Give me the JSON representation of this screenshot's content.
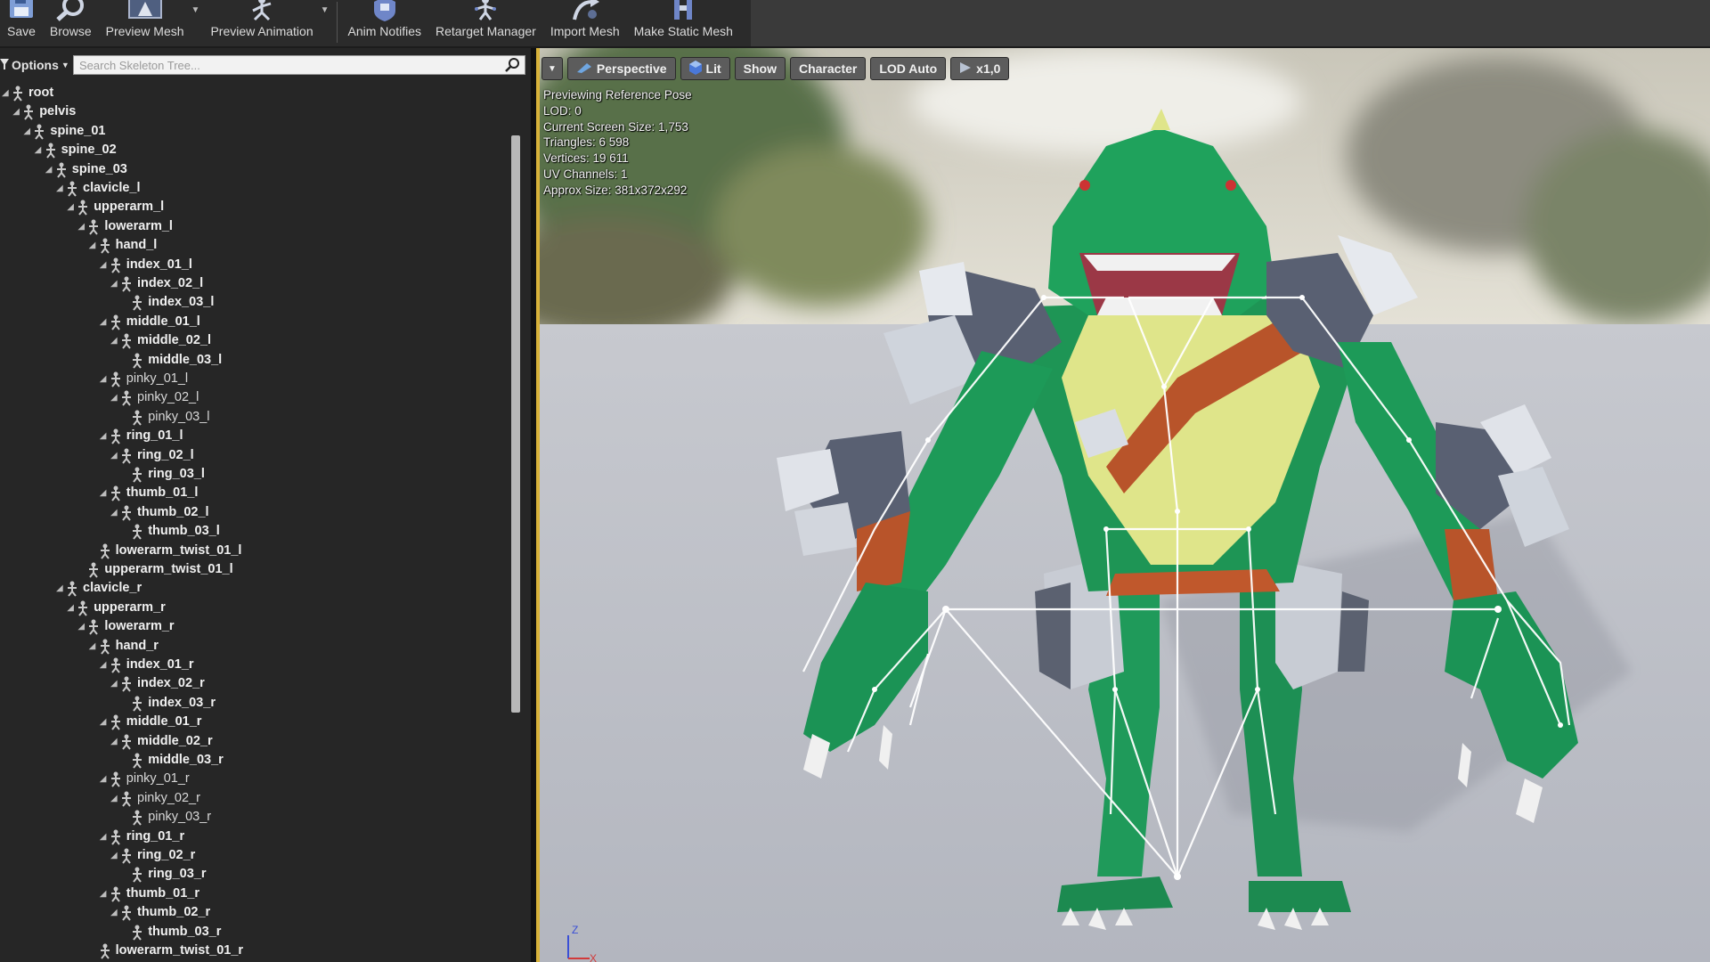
{
  "toolbar": {
    "items": [
      {
        "label": "Save",
        "icon": "save-icon"
      },
      {
        "label": "Browse",
        "icon": "browse-icon"
      },
      {
        "label": "Preview Mesh",
        "icon": "preview-mesh-icon"
      },
      {
        "label": "Preview Animation",
        "icon": "preview-animation-icon"
      },
      {
        "label": "Anim Notifies",
        "icon": "anim-notifies-icon"
      },
      {
        "label": "Retarget Manager",
        "icon": "retarget-manager-icon"
      },
      {
        "label": "Import Mesh",
        "icon": "import-mesh-icon"
      },
      {
        "label": "Make Static Mesh",
        "icon": "make-static-mesh-icon"
      }
    ]
  },
  "skeleton_panel": {
    "options_label": "Options",
    "search_placeholder": "Search Skeleton Tree...",
    "bones": [
      {
        "name": "root",
        "depth": 0,
        "expand": true,
        "bold": true
      },
      {
        "name": "pelvis",
        "depth": 1,
        "expand": true,
        "bold": true
      },
      {
        "name": "spine_01",
        "depth": 2,
        "expand": true,
        "bold": true
      },
      {
        "name": "spine_02",
        "depth": 3,
        "expand": true,
        "bold": true
      },
      {
        "name": "spine_03",
        "depth": 4,
        "expand": true,
        "bold": true
      },
      {
        "name": "clavicle_l",
        "depth": 5,
        "expand": true,
        "bold": true
      },
      {
        "name": "upperarm_l",
        "depth": 6,
        "expand": true,
        "bold": true
      },
      {
        "name": "lowerarm_l",
        "depth": 7,
        "expand": true,
        "bold": true
      },
      {
        "name": "hand_l",
        "depth": 8,
        "expand": true,
        "bold": true
      },
      {
        "name": "index_01_l",
        "depth": 9,
        "expand": true,
        "bold": true
      },
      {
        "name": "index_02_l",
        "depth": 10,
        "expand": true,
        "bold": true
      },
      {
        "name": "index_03_l",
        "depth": 11,
        "expand": false,
        "bold": true
      },
      {
        "name": "middle_01_l",
        "depth": 9,
        "expand": true,
        "bold": true
      },
      {
        "name": "middle_02_l",
        "depth": 10,
        "expand": true,
        "bold": true
      },
      {
        "name": "middle_03_l",
        "depth": 11,
        "expand": false,
        "bold": true
      },
      {
        "name": "pinky_01_l",
        "depth": 9,
        "expand": true,
        "bold": false
      },
      {
        "name": "pinky_02_l",
        "depth": 10,
        "expand": true,
        "bold": false
      },
      {
        "name": "pinky_03_l",
        "depth": 11,
        "expand": false,
        "bold": false
      },
      {
        "name": "ring_01_l",
        "depth": 9,
        "expand": true,
        "bold": true
      },
      {
        "name": "ring_02_l",
        "depth": 10,
        "expand": true,
        "bold": true
      },
      {
        "name": "ring_03_l",
        "depth": 11,
        "expand": false,
        "bold": true
      },
      {
        "name": "thumb_01_l",
        "depth": 9,
        "expand": true,
        "bold": true
      },
      {
        "name": "thumb_02_l",
        "depth": 10,
        "expand": true,
        "bold": true
      },
      {
        "name": "thumb_03_l",
        "depth": 11,
        "expand": false,
        "bold": true
      },
      {
        "name": "lowerarm_twist_01_l",
        "depth": 8,
        "expand": false,
        "bold": true
      },
      {
        "name": "upperarm_twist_01_l",
        "depth": 7,
        "expand": false,
        "bold": true
      },
      {
        "name": "clavicle_r",
        "depth": 5,
        "expand": true,
        "bold": true
      },
      {
        "name": "upperarm_r",
        "depth": 6,
        "expand": true,
        "bold": true
      },
      {
        "name": "lowerarm_r",
        "depth": 7,
        "expand": true,
        "bold": true
      },
      {
        "name": "hand_r",
        "depth": 8,
        "expand": true,
        "bold": true
      },
      {
        "name": "index_01_r",
        "depth": 9,
        "expand": true,
        "bold": true
      },
      {
        "name": "index_02_r",
        "depth": 10,
        "expand": true,
        "bold": true
      },
      {
        "name": "index_03_r",
        "depth": 11,
        "expand": false,
        "bold": true
      },
      {
        "name": "middle_01_r",
        "depth": 9,
        "expand": true,
        "bold": true
      },
      {
        "name": "middle_02_r",
        "depth": 10,
        "expand": true,
        "bold": true
      },
      {
        "name": "middle_03_r",
        "depth": 11,
        "expand": false,
        "bold": true
      },
      {
        "name": "pinky_01_r",
        "depth": 9,
        "expand": true,
        "bold": false
      },
      {
        "name": "pinky_02_r",
        "depth": 10,
        "expand": true,
        "bold": false
      },
      {
        "name": "pinky_03_r",
        "depth": 11,
        "expand": false,
        "bold": false
      },
      {
        "name": "ring_01_r",
        "depth": 9,
        "expand": true,
        "bold": true
      },
      {
        "name": "ring_02_r",
        "depth": 10,
        "expand": true,
        "bold": true
      },
      {
        "name": "ring_03_r",
        "depth": 11,
        "expand": false,
        "bold": true
      },
      {
        "name": "thumb_01_r",
        "depth": 9,
        "expand": true,
        "bold": true
      },
      {
        "name": "thumb_02_r",
        "depth": 10,
        "expand": true,
        "bold": true
      },
      {
        "name": "thumb_03_r",
        "depth": 11,
        "expand": false,
        "bold": true
      },
      {
        "name": "lowerarm_twist_01_r",
        "depth": 8,
        "expand": false,
        "bold": true
      }
    ]
  },
  "viewport": {
    "toolbar": {
      "menu_icon": "dropdown-arrow-icon",
      "perspective": "Perspective",
      "lit": "Lit",
      "show": "Show",
      "character": "Character",
      "lod": "LOD Auto",
      "speed": "x1,0"
    },
    "stats": [
      "Previewing Reference Pose",
      "LOD: 0",
      "Current Screen Size: 1,753",
      "Triangles: 6 598",
      "Vertices: 19 611",
      "UV Channels: 1",
      "Approx Size: 381x372x292"
    ],
    "axis": {
      "z": "Z",
      "x": "X"
    }
  },
  "colors": {
    "panel_bg": "#262626",
    "toolbar_bg": "#2b2b2b",
    "floor": "#b9bcc4",
    "character_green": "#1f9a5a",
    "belly": "#dfe58a",
    "strap": "#b8542a",
    "armor": "#c8ccd4",
    "bones": "#ffffff"
  }
}
